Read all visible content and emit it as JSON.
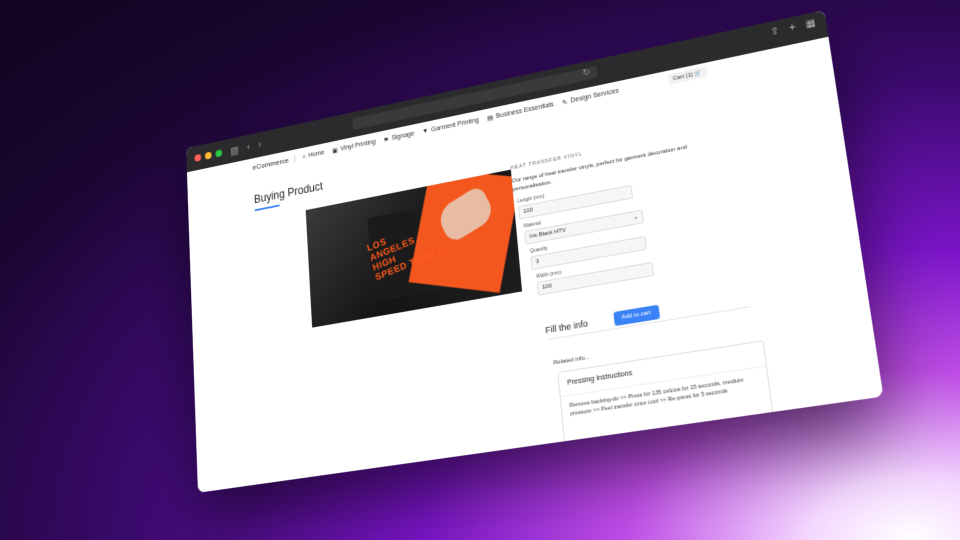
{
  "nav": {
    "brand": "eCommerce",
    "items": [
      {
        "label": "Home",
        "icon": "home-icon",
        "glyph": "⌂"
      },
      {
        "label": "Vinyl Printing",
        "icon": "vinyl-icon",
        "glyph": "▣"
      },
      {
        "label": "Signage",
        "icon": "signage-icon",
        "glyph": "⚑"
      },
      {
        "label": "Garment Printing",
        "icon": "shirt-icon",
        "glyph": "▼"
      },
      {
        "label": "Business Essentials",
        "icon": "briefcase-icon",
        "glyph": "▤"
      },
      {
        "label": "Design Services",
        "icon": "pen-icon",
        "glyph": "✎"
      }
    ],
    "cart_label": "Cart (1)",
    "cart_glyph": "🛒"
  },
  "page": {
    "title": "Buying Product"
  },
  "product": {
    "category": "HEAT TRANSFER VINYL",
    "description": "Our range of heat transfer vinyls, perfect for garment decoration and personalisation.",
    "image_print_lines": [
      "LOS",
      "ANGELES",
      "HIGH",
      "SPEED THRILLS"
    ]
  },
  "form": {
    "length_label": "Length (mm)",
    "length_value": "100",
    "material_label": "Material",
    "material_value": "Iris Black HTV",
    "quantity_label": "Quantity",
    "quantity_value": "3",
    "width_label": "Width (mm)",
    "width_value": "100"
  },
  "actions": {
    "fill_info": "Fill the info",
    "add_to_cart": "Add to cart"
  },
  "related": {
    "label": "Related info...",
    "panel_title": "Pressing Instructions",
    "panel_text": "Remove backing-do >> Press for 135 celcius for 15 seconds, medium pressure >> Peel transfer once cool >> Re-press for 5 seconds"
  }
}
